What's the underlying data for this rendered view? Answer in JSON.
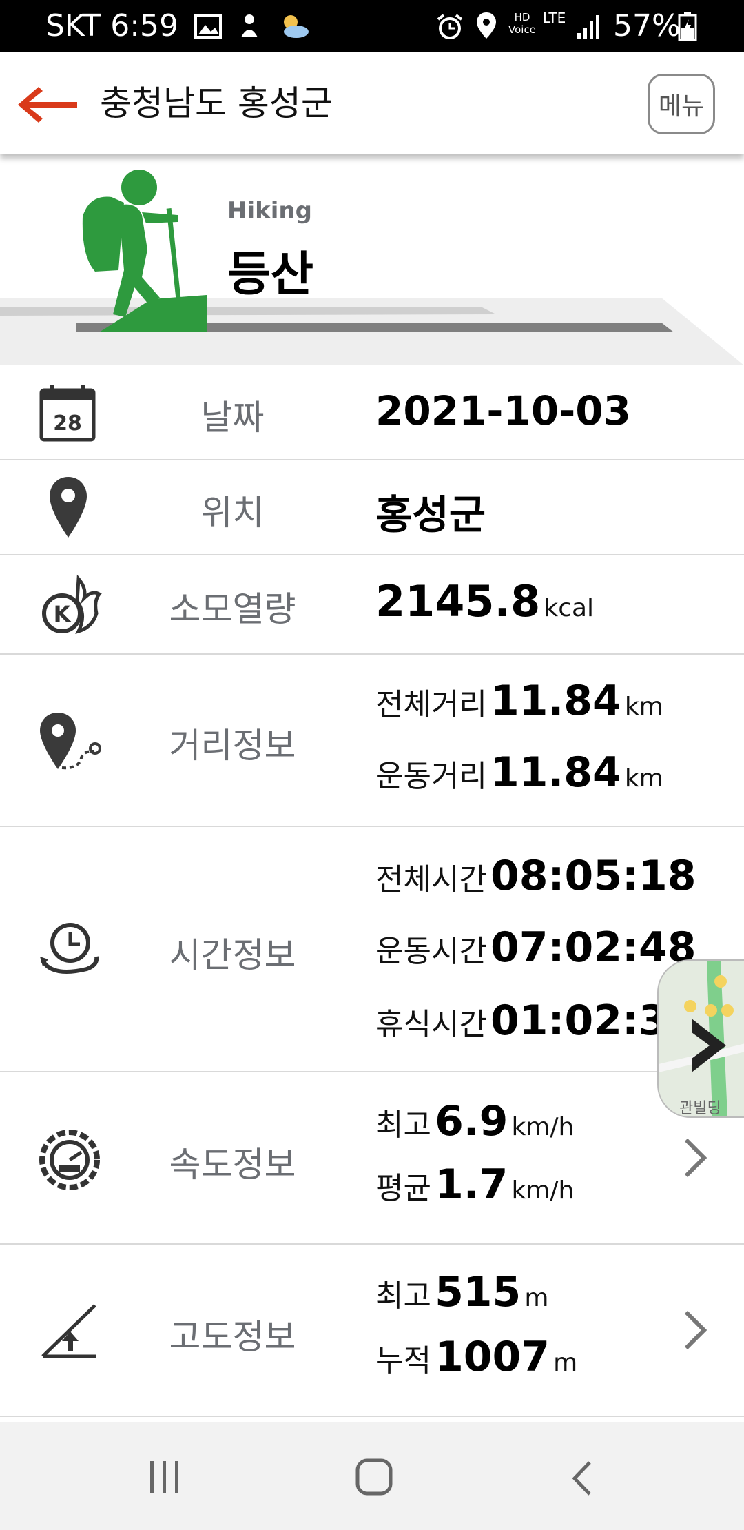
{
  "status_bar": {
    "carrier_time": "SKT 6:59",
    "network": "LTE",
    "hd_voice": "HD Voice",
    "battery": "57%"
  },
  "app_bar": {
    "title": "충청남도 홍성군",
    "menu_label": "메뉴"
  },
  "header": {
    "activity_en": "Hiking",
    "activity_ko": "등산",
    "accent_color": "#2e9a3e"
  },
  "rows": {
    "date": {
      "label": "날짜",
      "value": "2021-10-03",
      "calendar_day": "28"
    },
    "location": {
      "label": "위치",
      "value": "홍성군"
    },
    "calories": {
      "label": "소모열량",
      "value": "2145.8",
      "unit": "kcal",
      "badge": "K"
    },
    "distance": {
      "label": "거리정보",
      "total_label": "전체거리",
      "total_value": "11.84",
      "total_unit": "km",
      "moving_label": "운동거리",
      "moving_value": "11.84",
      "moving_unit": "km"
    },
    "time": {
      "label": "시간정보",
      "total_label": "전체시간",
      "total_value": "08:05:18",
      "moving_label": "운동시간",
      "moving_value": "07:02:48",
      "rest_label": "휴식시간",
      "rest_value": "01:02:3"
    },
    "speed": {
      "label": "속도정보",
      "max_label": "최고",
      "max_value": "6.9",
      "max_unit": "km/h",
      "avg_label": "평균",
      "avg_value": "1.7",
      "avg_unit": "km/h"
    },
    "altitude": {
      "label": "고도정보",
      "max_label": "최고",
      "max_value": "515",
      "max_unit": "m",
      "cum_label": "누적",
      "cum_value": "1007",
      "cum_unit": "m"
    }
  },
  "map_thumbnail": {
    "text": "관빌딩"
  }
}
